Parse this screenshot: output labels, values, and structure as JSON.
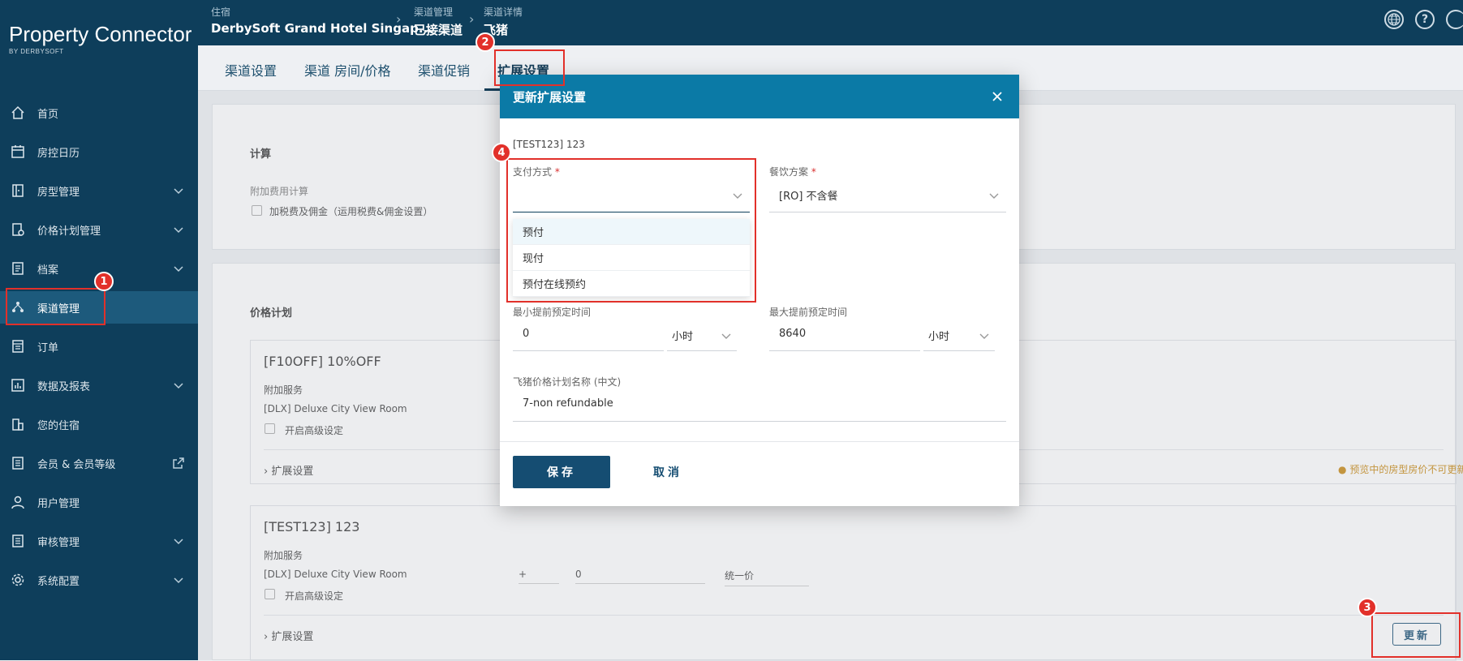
{
  "app": {
    "title": "Property Connector",
    "subtitle": "BY DERBYSOFT"
  },
  "sidebar": {
    "items": [
      {
        "label": "首页",
        "icon": "home-icon"
      },
      {
        "label": "房控日历",
        "icon": "calendar-icon"
      },
      {
        "label": "房型管理",
        "icon": "door-icon"
      },
      {
        "label": "价格计划管理",
        "icon": "price-plan-icon"
      },
      {
        "label": "档案",
        "icon": "document-icon"
      },
      {
        "label": "渠道管理",
        "icon": "channel-icon"
      },
      {
        "label": "订单",
        "icon": "order-icon"
      },
      {
        "label": "数据及报表",
        "icon": "chart-icon"
      },
      {
        "label": "您的住宿",
        "icon": "building-icon"
      },
      {
        "label": "会员 & 会员等级",
        "icon": "member-icon"
      },
      {
        "label": "用户管理",
        "icon": "user-icon"
      },
      {
        "label": "审核管理",
        "icon": "audit-icon"
      },
      {
        "label": "系统配置",
        "icon": "settings-icon"
      }
    ]
  },
  "breadcrumb": [
    {
      "small": "住宿",
      "big": "DerbySoft Grand Hotel Singap..."
    },
    {
      "small": "渠道管理",
      "big": "已接渠道"
    },
    {
      "small": "渠道详情",
      "big": "飞猪"
    }
  ],
  "tabs": [
    "渠道设置",
    "渠道 房间/价格",
    "渠道促销",
    "扩展设置"
  ],
  "background": {
    "calc_title": "计算",
    "extra_fee_label": "附加费用计算",
    "extra_fee_checkbox": "加税费及佣金（运用税费&佣金设置）",
    "price_plan_title": "价格计划",
    "plan1": {
      "title": "[F10OFF] 10%OFF",
      "service_label": "附加服务",
      "room": "[DLX] Deluxe City View Room",
      "advanced": "开启高级设定",
      "expand": "扩展设置"
    },
    "plan2": {
      "title": "[TEST123] 123",
      "service_label": "附加服务",
      "room": "[DLX] Deluxe City View Room",
      "advanced": "开启高级设定",
      "expand": "扩展设置",
      "op": "+",
      "amount": "0",
      "price_mode": "统一价"
    },
    "warning": "预览中的房型房价不可更新。",
    "update_button": "更新"
  },
  "modal": {
    "title": "更新扩展设置",
    "plan_ref": "[TEST123] 123",
    "payment_label": "支付方式",
    "payment_value": "",
    "payment_options": [
      "预付",
      "现付",
      "预付在线预约"
    ],
    "meal_label": "餐饮方案",
    "meal_value": "[RO] 不含餐",
    "min_label": "最小提前预定时间",
    "min_value": "0",
    "min_unit": "小时",
    "max_label": "最大提前预定时间",
    "max_value": "8640",
    "max_unit": "小时",
    "name_label": "飞猪价格计划名称 (中文)",
    "name_value": "7-non refundable",
    "save": "保存",
    "cancel": "取消",
    "required_mark": "*"
  },
  "annotations": [
    "1",
    "2",
    "3",
    "4"
  ]
}
